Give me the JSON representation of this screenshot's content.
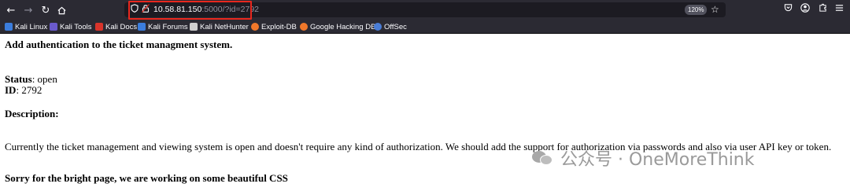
{
  "browser": {
    "nav": {
      "back_icon": "arrow-left-icon",
      "forward_icon": "arrow-right-icon",
      "reload_icon": "reload-icon",
      "home_icon": "home-icon"
    },
    "url": {
      "host": "10.58.81.150",
      "rest": ":5000/?id=2792",
      "highlight_color": "#e8271e"
    },
    "zoom_level": "120%",
    "toolbar_icons": [
      "pocket-icon",
      "account-icon",
      "extensions-icon",
      "menu-icon"
    ],
    "bookmarks": [
      {
        "label": "Kali Linux",
        "icon": "kali-dragon-icon",
        "color": "#3b7ddd"
      },
      {
        "label": "Kali Tools",
        "icon": "kali-tools-icon",
        "color": "#6a5acd"
      },
      {
        "label": "Kali Docs",
        "icon": "kali-docs-icon",
        "color": "#d9342b"
      },
      {
        "label": "Kali Forums",
        "icon": "kali-forums-icon",
        "color": "#3b7ddd"
      },
      {
        "label": "Kali NetHunter",
        "icon": "nethunter-icon",
        "color": "#cfcfcf"
      },
      {
        "label": "Exploit-DB",
        "icon": "exploit-db-icon",
        "color": "#f0782a"
      },
      {
        "label": "Google Hacking DB",
        "icon": "ghdb-icon",
        "color": "#f0782a"
      },
      {
        "label": "OffSec",
        "icon": "offsec-icon",
        "color": "#4a7dd6"
      }
    ]
  },
  "ticket": {
    "title": "Add authentication to the ticket managment system.",
    "status_label": "Status",
    "status_value": ": open",
    "id_label": "ID",
    "id_value": ": 2792",
    "description_heading": "Description:",
    "description": "Currently the ticket management and viewing system is open and doesn't require any kind of authorization. We should add the support for authorization via passwords and also via user API key or token.",
    "footer_note": "Sorry for the bright page, we are working on some beautiful CSS"
  },
  "watermark": {
    "text": "公众号 · OneMoreThink",
    "icon": "wechat-icon"
  }
}
